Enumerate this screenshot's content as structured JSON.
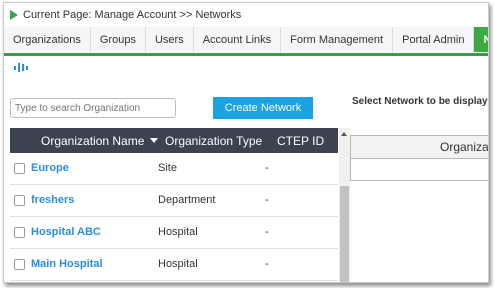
{
  "breadcrumb": {
    "text": "Current Page: Manage Account >> Networks"
  },
  "tabs": [
    {
      "label": "Organizations",
      "active": false
    },
    {
      "label": "Groups",
      "active": false
    },
    {
      "label": "Users",
      "active": false
    },
    {
      "label": "Account Links",
      "active": false
    },
    {
      "label": "Form Management",
      "active": false
    },
    {
      "label": "Portal Admin",
      "active": false
    },
    {
      "label": "Networks",
      "active": true
    }
  ],
  "search": {
    "placeholder": "Type to search Organization",
    "value": ""
  },
  "create_button_label": "Create Network",
  "select_network_label": "Select Network to be displayed",
  "table": {
    "columns": [
      "Organization Name",
      "Organization Type",
      "CTEP ID"
    ],
    "sort_column": "Organization Name",
    "sort_direction": "descending",
    "rows": [
      {
        "name": "Europe",
        "type": "Site",
        "ctep": "-"
      },
      {
        "name": "freshers",
        "type": "Department",
        "ctep": "-"
      },
      {
        "name": "Hospital ABC",
        "type": "Hospital",
        "ctep": "-"
      },
      {
        "name": "Main Hospital",
        "type": "Hospital",
        "ctep": "-"
      }
    ]
  },
  "right_panel": {
    "header_text": "Organizat"
  },
  "colors": {
    "accent_green": "#3da944",
    "header_dark": "#3b4250",
    "button_blue": "#1aa3e0",
    "link_blue": "#2a8fd8"
  },
  "icons": {
    "breadcrumb": "play-triangle-icon",
    "toolbar": "bars-icon"
  }
}
